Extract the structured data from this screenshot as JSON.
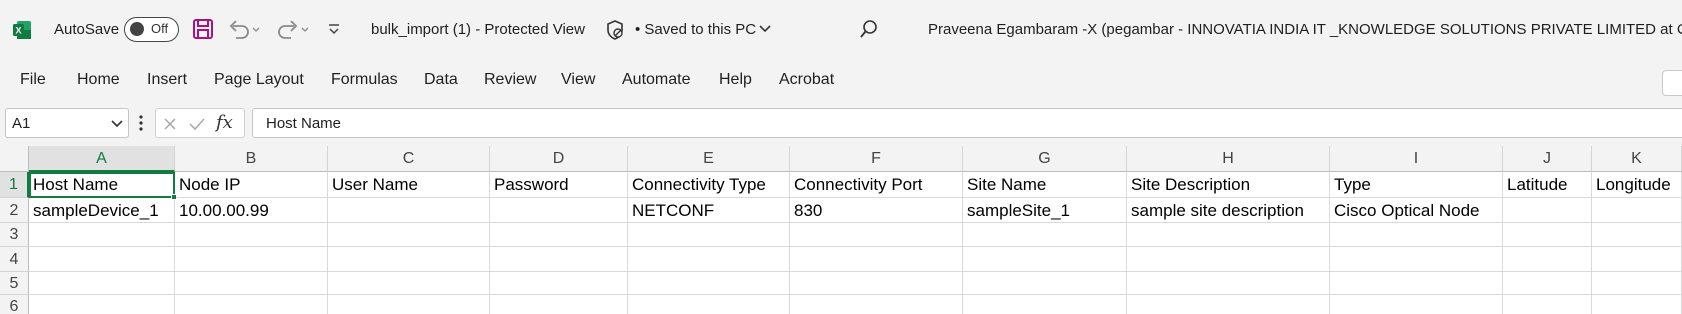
{
  "titlebar": {
    "autosave_label": "AutoSave",
    "autosave_state": "Off",
    "file_title": "bulk_import (1)  -  Protected View",
    "saved_status": "• Saved to this PC",
    "user": "Praveena Egambaram -X (pegambar - INNOVATIA INDIA IT _KNOWLEDGE SOLUTIONS PRIVATE LIMITED at Cisco)"
  },
  "menu": [
    "File",
    "Home",
    "Insert",
    "Page Layout",
    "Formulas",
    "Data",
    "Review",
    "View",
    "Automate",
    "Help",
    "Acrobat"
  ],
  "formula_bar": {
    "name_box": "A1",
    "fx_label": "fx",
    "content": "Host Name"
  },
  "columns": [
    "A",
    "B",
    "C",
    "D",
    "E",
    "F",
    "G",
    "H",
    "I",
    "J",
    "K"
  ],
  "row_numbers": [
    "1",
    "2",
    "3",
    "4",
    "5",
    "6"
  ],
  "rows": [
    [
      "Host Name",
      "Node IP",
      "User Name",
      "Password",
      "Connectivity Type",
      "Connectivity Port",
      "Site Name",
      "Site Description",
      "Type",
      "Latitude",
      "Longitude"
    ],
    [
      "sampleDevice_1",
      "10.00.00.99",
      "",
      "",
      "NETCONF",
      "830",
      "sampleSite_1",
      "sample site description",
      "Cisco Optical Node",
      "",
      ""
    ],
    [
      "",
      "",
      "",
      "",
      "",
      "",
      "",
      "",
      "",
      "",
      ""
    ],
    [
      "",
      "",
      "",
      "",
      "",
      "",
      "",
      "",
      "",
      "",
      ""
    ],
    [
      "",
      "",
      "",
      "",
      "",
      "",
      "",
      "",
      "",
      "",
      ""
    ],
    [
      "",
      "",
      "",
      "",
      "",
      "",
      "",
      "",
      "",
      "",
      ""
    ]
  ],
  "colors": {
    "excel_green": "#107c41",
    "save_icon": "#a9127f"
  }
}
